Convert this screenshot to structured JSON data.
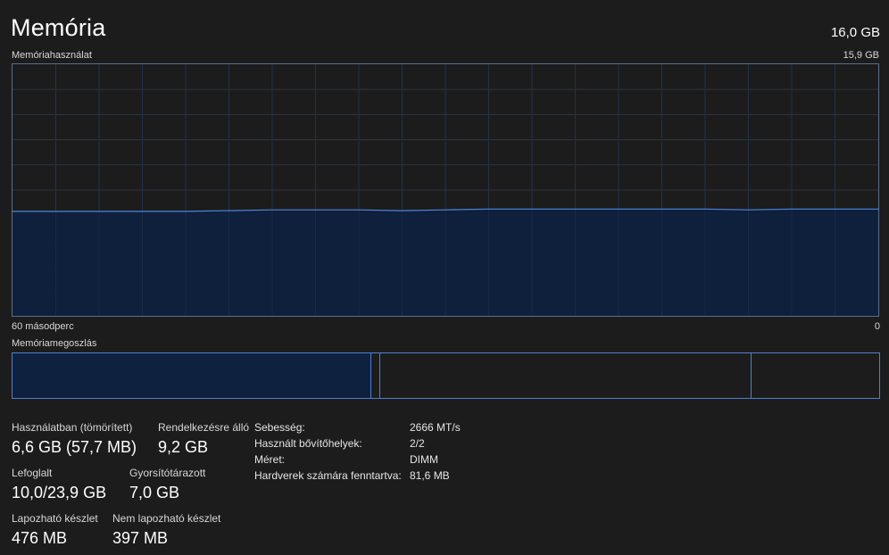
{
  "header": {
    "title": "Memória",
    "total": "16,0 GB"
  },
  "usage_graph": {
    "label": "Memóriahasználat",
    "max_label": "15,9 GB",
    "time_label_left": "60 másodperc",
    "time_label_right": "0",
    "series": {
      "x_seconds": [
        60,
        54,
        48,
        42,
        36,
        33,
        30,
        27,
        24,
        21,
        18,
        15,
        12,
        9,
        6,
        0
      ],
      "used_gb": [
        6.6,
        6.6,
        6.6,
        6.7,
        6.7,
        6.65,
        6.7,
        6.75,
        6.75,
        6.75,
        6.75,
        6.75,
        6.75,
        6.7,
        6.75,
        6.75
      ],
      "max_gb": 15.9
    },
    "colors": {
      "line": "#4f86d9",
      "fill": "#0e213e",
      "grid": "#2f3542",
      "border": "#5b6f8c"
    }
  },
  "composition": {
    "label": "Memóriamegoszlás",
    "segments": [
      {
        "name": "in-use",
        "fraction": 0.4145
      },
      {
        "name": "modified",
        "fraction": 0.0103
      },
      {
        "name": "standby",
        "fraction": 0.4282
      },
      {
        "name": "free",
        "fraction": 0.147
      }
    ],
    "colors": {
      "in_use_fill": "#0e213e",
      "border": "#4f7fcf"
    }
  },
  "stats": {
    "in_use_label": "Használatban (tömörített)",
    "in_use_value": "6,6 GB (57,7 MB)",
    "available_label": "Rendelkezésre álló",
    "available_value": "9,2 GB",
    "committed_label": "Lefoglalt",
    "committed_value": "10,0/23,9 GB",
    "cached_label": "Gyorsítótárazott",
    "cached_value": "7,0 GB",
    "paged_pool_label": "Lapozható készlet",
    "paged_pool_value": "476 MB",
    "nonpaged_pool_label": "Nem lapozható készlet",
    "nonpaged_pool_value": "397 MB"
  },
  "properties": {
    "speed_label": "Sebesség:",
    "speed_value": "2666 MT/s",
    "slots_label": "Használt bővítőhelyek:",
    "slots_value": "2/2",
    "form_label": "Méret:",
    "form_value": "DIMM",
    "reserved_label": "Hardverek számára fenntartva:",
    "reserved_value": "81,6 MB"
  }
}
